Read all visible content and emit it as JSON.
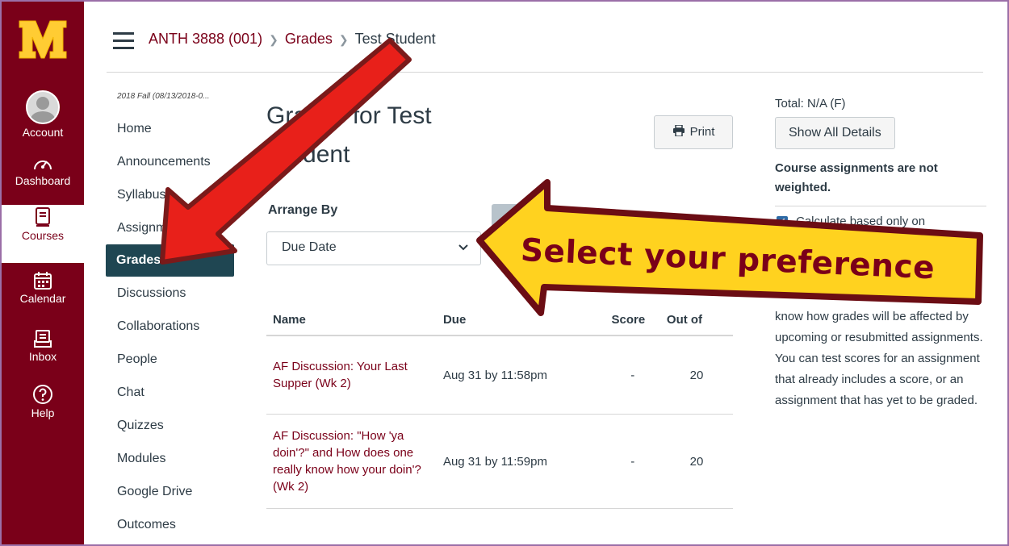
{
  "global_nav": {
    "items": [
      {
        "label": "Account",
        "icon": "avatar"
      },
      {
        "label": "Dashboard",
        "icon": "speedometer-icon"
      },
      {
        "label": "Courses",
        "icon": "book-icon"
      },
      {
        "label": "Calendar",
        "icon": "calendar-icon"
      },
      {
        "label": "Inbox",
        "icon": "inbox-icon"
      },
      {
        "label": "Help",
        "icon": "help-icon"
      }
    ],
    "brand_color": "#7a0019",
    "accent_color": "#ffcc33"
  },
  "breadcrumb": {
    "course": "ANTH 3888 (001)",
    "section": "Grades",
    "student": "Test Student"
  },
  "course_nav": {
    "term": "2018 Fall (08/13/2018-0...",
    "items": [
      "Home",
      "Announcements",
      "Syllabus",
      "Assignm",
      "Grades",
      "Discussions",
      "Collaborations",
      "People",
      "Chat",
      "Quizzes",
      "Modules",
      "Google Drive",
      "Outcomes"
    ]
  },
  "main": {
    "title_line1": "Grades for Test",
    "title_line2": "Student",
    "print_label": "Print",
    "arrange_label": "Arrange By",
    "arrange_value": "Due Date",
    "table": {
      "headers": [
        "Name",
        "Due",
        "Score",
        "Out of"
      ],
      "rows": [
        {
          "name": "AF Discussion: Your Last Supper (Wk 2)",
          "due": "Aug 31 by 11:58pm",
          "score": "-",
          "out_of": "20"
        },
        {
          "name": "AF Discussion: \"How 'ya doin'?\" and How does one really know how your doin'? (Wk 2)",
          "due": "Aug 31 by 11:59pm",
          "score": "-",
          "out_of": "20"
        }
      ]
    }
  },
  "sidebar": {
    "total": "Total: N/A (F)",
    "show_all": "Show All Details",
    "weight_note": "Course assignments are not weighted.",
    "calc_label": "Calculate based only on",
    "what_if": "know how grades will be affected by upcoming or resubmitted assignments. You can test scores for an assignment that already includes a score, or an assignment that has yet to be graded."
  },
  "annotation": {
    "callout": "Select your preference",
    "arrow_color": "#e8201a",
    "callout_fill": "#ffd21f"
  }
}
